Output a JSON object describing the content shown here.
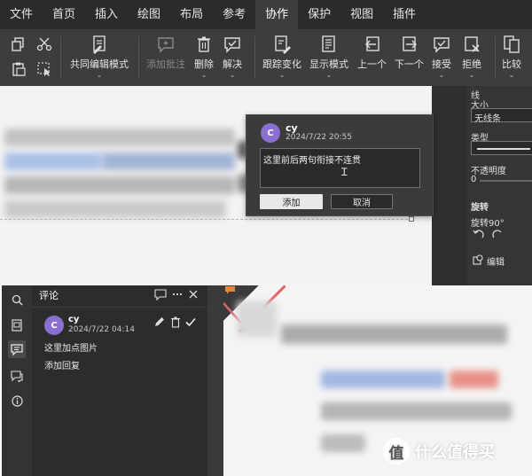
{
  "menu": {
    "items": [
      {
        "label": "文件",
        "active": false
      },
      {
        "label": "首页",
        "active": false
      },
      {
        "label": "插入",
        "active": false
      },
      {
        "label": "绘图",
        "active": false
      },
      {
        "label": "布局",
        "active": false
      },
      {
        "label": "参考",
        "active": false
      },
      {
        "label": "协作",
        "active": true
      },
      {
        "label": "保护",
        "active": false
      },
      {
        "label": "视图",
        "active": false
      },
      {
        "label": "插件",
        "active": false
      }
    ]
  },
  "ribbon": {
    "co_edit": "共同编辑模式",
    "add_comment": "添加批注",
    "delete": "删除",
    "resolve": "解决",
    "track_changes": "跟踪变化",
    "display_mode": "显示模式",
    "prev": "上一个",
    "next": "下一个",
    "accept": "接受",
    "reject": "拒绝",
    "compare": "比较"
  },
  "right_panel": {
    "line": "线",
    "size": "大小",
    "size_value": "无线条",
    "type": "类型",
    "opacity": "不透明度",
    "opacity_value": "0",
    "rotate": "旋转",
    "rotate90": "旋转90°",
    "edit": "编辑"
  },
  "comment_popup": {
    "avatar_letter": "C",
    "author": "cy",
    "date": "2024/7/22 20:55",
    "input_value": "这里前后两句衔接不连贯",
    "add_button": "添加",
    "cancel_button": "取消"
  },
  "comments_panel": {
    "title": "评论",
    "comment": {
      "avatar_letter": "C",
      "author": "cy",
      "date": "2024/7/22 04:14",
      "text": "这里加点图片",
      "add_reply": "添加回复"
    }
  },
  "watermark": {
    "logo": "值",
    "text": "什么值得买"
  },
  "colors": {
    "avatar": "#8b6fd0",
    "menubar": "#2b2b2b",
    "ribbon": "#3d3d3d",
    "panel": "#2c2c2c"
  }
}
